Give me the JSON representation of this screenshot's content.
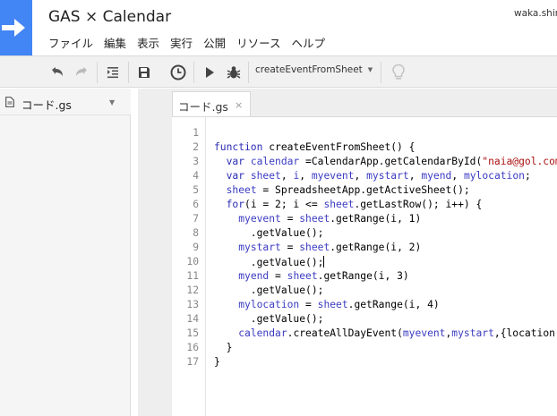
{
  "app": {
    "title": "GAS × Calendar",
    "user": "waka.shira"
  },
  "menu": [
    "ファイル",
    "編集",
    "表示",
    "実行",
    "公開",
    "リソース",
    "ヘルプ"
  ],
  "toolbar": {
    "function_select": "createEventFromSheet",
    "icons": [
      "undo-icon",
      "redo-icon",
      "indent-icon",
      "save-icon",
      "triggers-clock-icon",
      "run-icon",
      "debug-bug-icon",
      "lightbulb-icon"
    ]
  },
  "files": [
    {
      "name": "コード.gs"
    }
  ],
  "tabs": [
    {
      "name": "コード.gs",
      "close": "×"
    }
  ],
  "code": {
    "line_numbers": [
      "1",
      "2",
      "3",
      "4",
      "5",
      "6",
      "7",
      "8",
      "9",
      "10",
      "11",
      "12",
      "13",
      "14",
      "15",
      "16",
      "17"
    ],
    "cursor_line": 10
  },
  "colors": {
    "accent": "#4285f4",
    "keyword": "#2b2bb5",
    "string": "#aa1111",
    "toolbar_bg": "#f1f1f1"
  }
}
